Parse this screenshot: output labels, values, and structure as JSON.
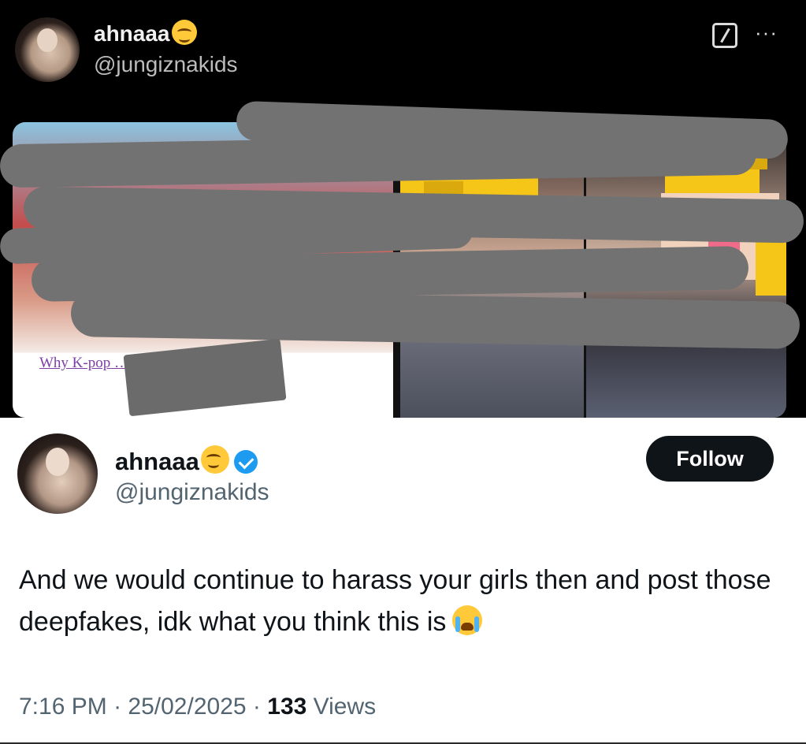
{
  "top_tweet": {
    "display_name": "ahnaaa",
    "handle": "@jungiznakids",
    "article_caption": "Why K-pop … & TWICE’s … To Date"
  },
  "bottom_tweet": {
    "display_name": "ahnaaa",
    "handle": "@jungiznakids",
    "follow_label": "Follow",
    "text": "And we would continue to harass your girls then and post those deepfakes, idk what you think this is",
    "time": "7:16 PM",
    "date": "25/02/2025",
    "views_count": "133",
    "views_label": "Views",
    "separator": "·"
  },
  "icons": {
    "name_emoji": "smiling-face-with-smiling-eyes",
    "verified": "verified-badge",
    "text_emoji": "loudly-crying-face",
    "edit": "edit-square",
    "more": "ellipsis"
  },
  "colors": {
    "verified": "#1d9bf0",
    "follow_bg": "#0f1419",
    "caption_link": "#7b3fa6"
  }
}
